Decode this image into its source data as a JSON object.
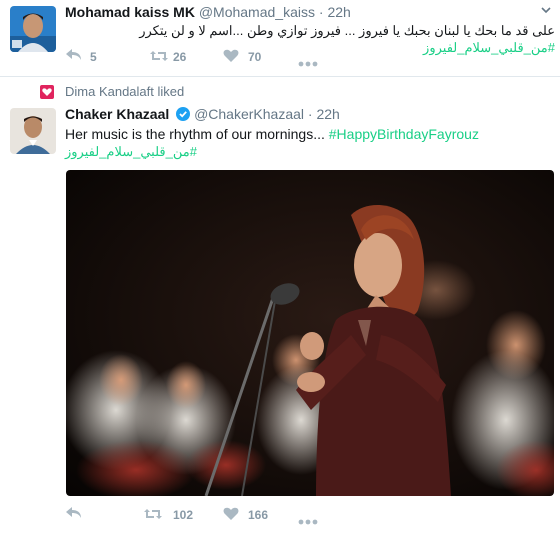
{
  "tweets": [
    {
      "name": "Mohamad kaiss MK",
      "handle": "@Mohamad_kaiss",
      "time": "22h",
      "text": "على قد ما بحك يا لبنان بحبك يا فيروز ... فيروز توازي  وطن    ...اسم لا و لن يتكرر",
      "hashtag": "#من_قلبي_سلام_لفيروز",
      "actions": {
        "reply": "5",
        "retweets": "26",
        "likes": "70"
      }
    },
    {
      "liked_by": "Dima Kandalaft liked",
      "name": "Chaker Khazaal",
      "handle": "@ChakerKhazaal",
      "time": "22h",
      "text": "Her music is the rhythm of our mornings...",
      "hashtag": "#HappyBirthdayFayrouz",
      "hashtag2": "#من_قلبي_سلام_لفيروز",
      "actions": {
        "retweets": "102",
        "likes": "166"
      }
    }
  ],
  "icons": {
    "reply": "reply-icon",
    "retweet": "retweet-icon",
    "like": "heart-icon",
    "more": "more-dots-icon",
    "caret": "caret-icon",
    "verified": "verified-badge-icon",
    "liked_badge": "heart-badge-icon"
  },
  "colors": {
    "hashtag": "#19cf86",
    "meta": "#657786",
    "action": "#aab8c2",
    "liked_badge": "#e0245e",
    "verified": "#1da1f2"
  }
}
